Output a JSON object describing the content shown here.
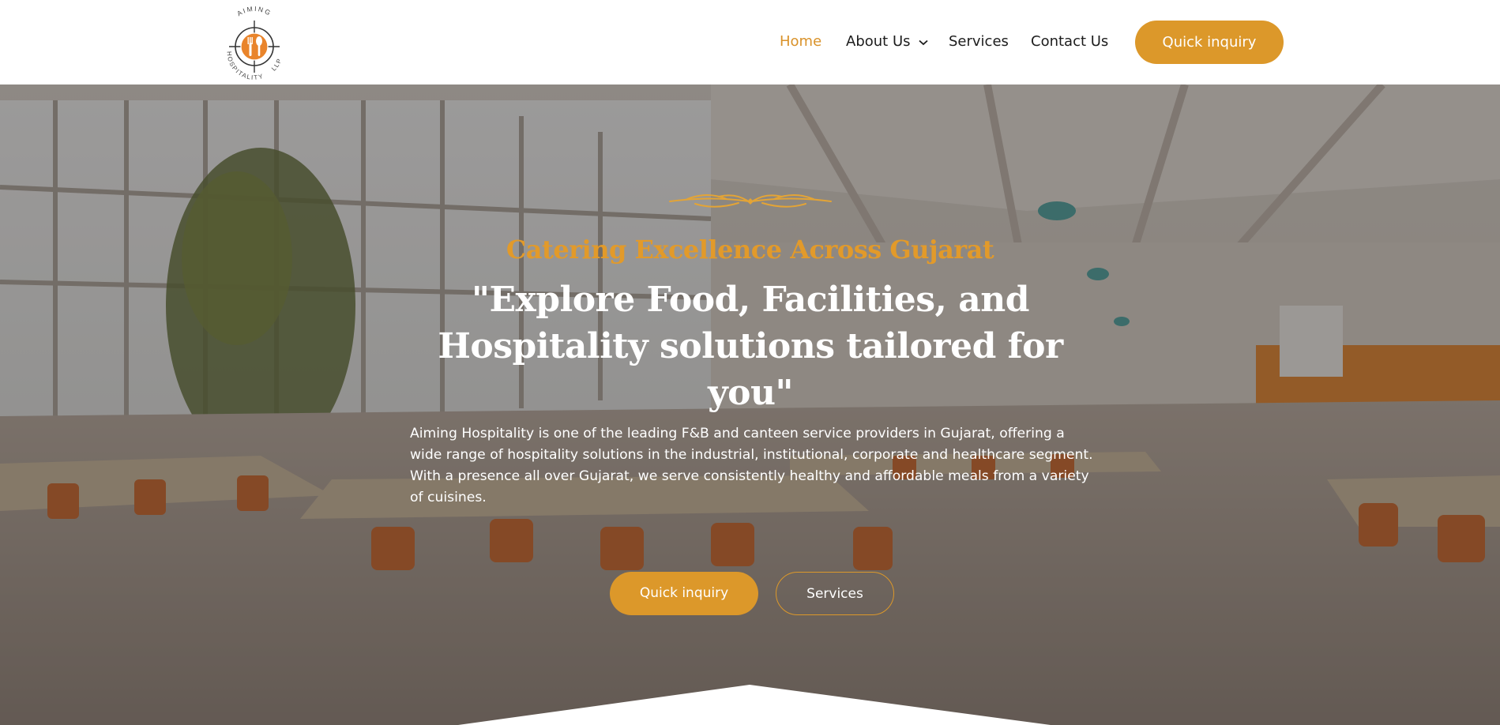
{
  "brand": {
    "logo_text_top": "AIMING",
    "logo_text_bottom": "HOSPITALITY",
    "logo_text_side": "LLP",
    "accent_color": "#dc982a"
  },
  "nav": {
    "items": [
      {
        "label": "Home",
        "active": true
      },
      {
        "label": "About Us",
        "has_dropdown": true
      },
      {
        "label": "Services"
      },
      {
        "label": "Contact Us"
      }
    ],
    "cta_label": "Quick inquiry"
  },
  "hero": {
    "tagline": "Catering Excellence Across Gujarat",
    "headline": "\"Explore Food, Facilities, and Hospitality solutions tailored for you\"",
    "description_1": "Aiming Hospitality is one of the leading F&B and canteen service providers in Gujarat, offering a wide range of hospitality solutions in the industrial, institutional, corporate and healthcare segment.",
    "description_2": "With a presence all over Gujarat, we serve consistently healthy and affordable meals from a variety of cuisines.",
    "primary_button": "Quick inquiry",
    "secondary_button": "Services"
  }
}
